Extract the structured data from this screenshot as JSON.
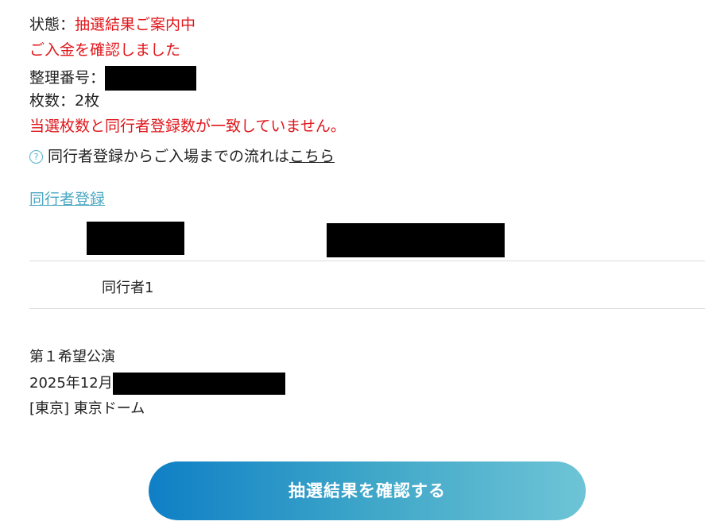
{
  "status": {
    "label": "状態：",
    "value": "抽選結果ご案内中"
  },
  "payment_message": "ご入金を確認しました",
  "ticket": {
    "number_label": "整理番号：",
    "count_label": "枚数：",
    "count_value": "2枚"
  },
  "warning_message": "当選枚数と同行者登録数が一致していません。",
  "help": {
    "text": "同行者登録からご入場までの流れは",
    "link_label": "こちら"
  },
  "companion_registration_link": "同行者登録",
  "companion_table": {
    "rows": [
      {
        "label": "同行者1"
      }
    ]
  },
  "performance": {
    "preference_label": "第１希望公演",
    "date_prefix": "2025年12月",
    "venue": "[東京] 東京ドーム"
  },
  "cta_button_label": "抽選結果を確認する",
  "colors": {
    "alert_red": "#e0161b",
    "link_teal": "#4aa8c2",
    "button_gradient_start": "#0f7fc6",
    "button_gradient_end": "#6ec4d6"
  }
}
